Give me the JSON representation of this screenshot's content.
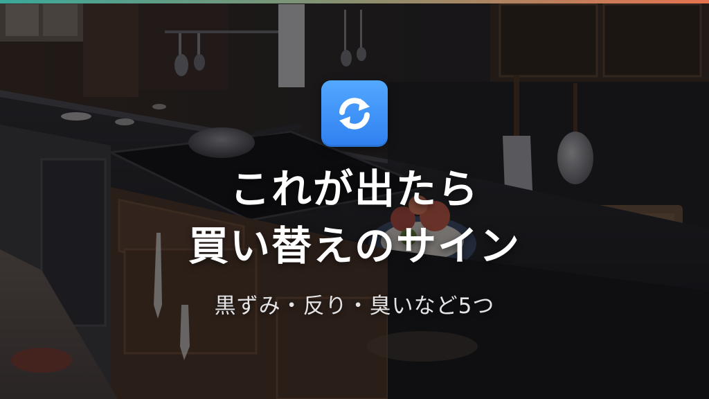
{
  "accent_bar": {
    "colors": [
      "#3aa99b",
      "#8a8f6e",
      "#e6734f"
    ]
  },
  "background": {
    "kind": "photo",
    "subject": "dark-kitchen-countertop"
  },
  "icon": {
    "name": "refresh-arrows-icon",
    "color": "#2f80f0"
  },
  "headline": {
    "line1": "これが出たら",
    "line2": "買い替えのサイン"
  },
  "subheadline": "黒ずみ・反り・臭いなど5つ"
}
